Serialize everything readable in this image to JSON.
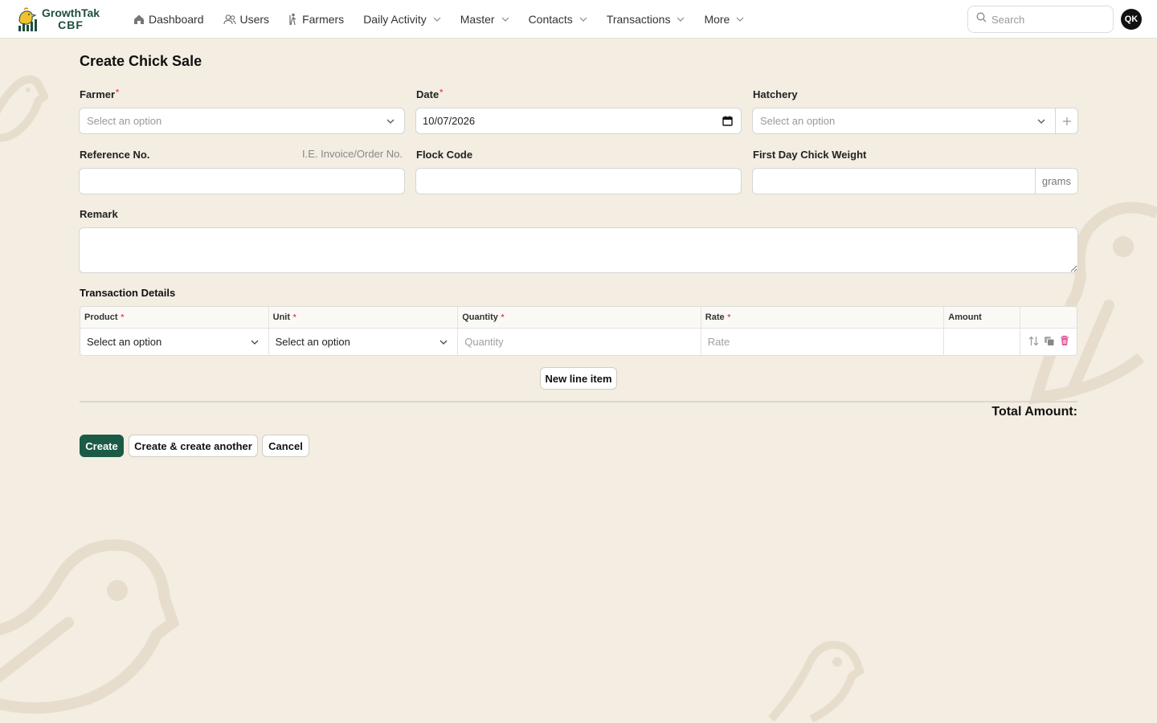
{
  "brand": {
    "name": "GrowthTak",
    "sub": "CBF"
  },
  "nav": {
    "items": [
      {
        "label": "Dashboard"
      },
      {
        "label": "Users"
      },
      {
        "label": "Farmers"
      },
      {
        "label": "Daily Activity"
      },
      {
        "label": "Master"
      },
      {
        "label": "Contacts"
      },
      {
        "label": "Transactions"
      },
      {
        "label": "More"
      }
    ]
  },
  "search": {
    "placeholder": "Search"
  },
  "user": {
    "initials": "QK"
  },
  "form": {
    "title": "Create Chick Sale",
    "farmer": {
      "label": "Farmer",
      "placeholder": "Select an option",
      "required": true
    },
    "date": {
      "label": "Date",
      "value": "10/07/2026",
      "required": true
    },
    "hatchery": {
      "label": "Hatchery",
      "placeholder": "Select an option"
    },
    "reference": {
      "label": "Reference No.",
      "hint": "I.E. Invoice/Order No.",
      "value": ""
    },
    "flock_code": {
      "label": "Flock Code",
      "value": ""
    },
    "chick_weight": {
      "label": "First Day Chick Weight",
      "suffix": "grams",
      "value": ""
    },
    "remark": {
      "label": "Remark",
      "value": ""
    }
  },
  "transaction": {
    "title": "Transaction Details",
    "columns": [
      "Product",
      "Unit",
      "Quantity",
      "Rate",
      "Amount"
    ],
    "rows": [
      {
        "product": "Select an option",
        "unit": "Select an option",
        "quantity_placeholder": "Quantity",
        "rate_placeholder": "Rate",
        "amount": ""
      }
    ],
    "new_line_label": "New line item",
    "total_label": "Total Amount:"
  },
  "actions": {
    "create": "Create",
    "create_another": "Create & create another",
    "cancel": "Cancel"
  },
  "colors": {
    "accent": "#1b5b46",
    "background": "#f3ede2",
    "required": "#e0455a",
    "delete": "#e05c9c"
  }
}
